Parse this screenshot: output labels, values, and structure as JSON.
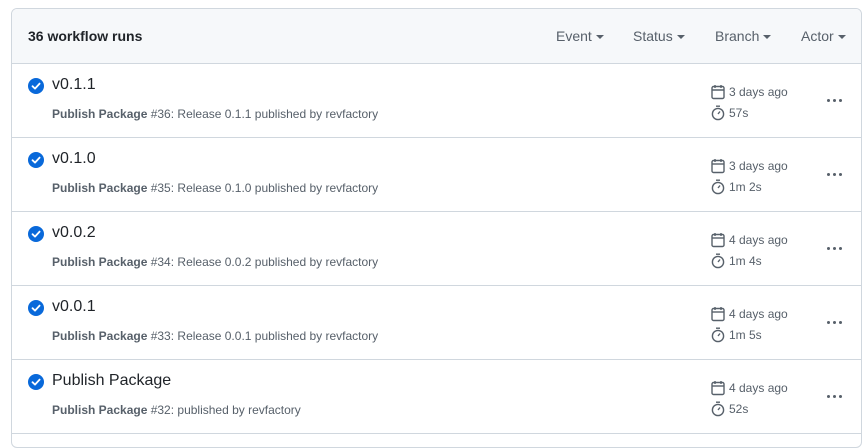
{
  "header": {
    "title": "36 workflow runs",
    "filters": {
      "event": "Event",
      "status": "Status",
      "branch": "Branch",
      "actor": "Actor"
    }
  },
  "colors": {
    "success": "#0969da",
    "muted": "#57606a",
    "border": "#d0d7de"
  },
  "runs": [
    {
      "title": "v0.1.1",
      "workflow": "Publish Package",
      "number": " #36: Release 0.1.1 published by revfactory",
      "date": "3 days ago",
      "duration": "57s",
      "status_icon": "check-circle-icon"
    },
    {
      "title": "v0.1.0",
      "workflow": "Publish Package",
      "number": " #35: Release 0.1.0 published by revfactory",
      "date": "3 days ago",
      "duration": "1m 2s",
      "status_icon": "check-circle-icon"
    },
    {
      "title": "v0.0.2",
      "workflow": "Publish Package",
      "number": " #34: Release 0.0.2 published by revfactory",
      "date": "4 days ago",
      "duration": "1m 4s",
      "status_icon": "check-circle-icon"
    },
    {
      "title": "v0.0.1",
      "workflow": "Publish Package",
      "number": " #33: Release 0.0.1 published by revfactory",
      "date": "4 days ago",
      "duration": "1m 5s",
      "status_icon": "check-circle-icon"
    },
    {
      "title": "Publish Package",
      "workflow": "Publish Package",
      "number": " #32: published by revfactory",
      "date": "4 days ago",
      "duration": "52s",
      "status_icon": "check-circle-icon"
    }
  ]
}
